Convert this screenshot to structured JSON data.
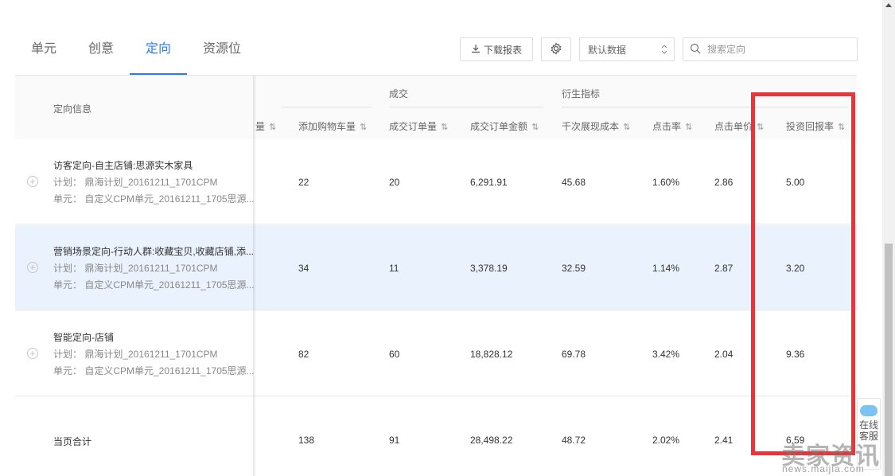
{
  "tabs": [
    {
      "label": "单元"
    },
    {
      "label": "创意"
    },
    {
      "label": "定向"
    },
    {
      "label": "资源位"
    }
  ],
  "active_tab": "定向",
  "toolbar": {
    "download_label": "下载报表",
    "select_value": "默认数据",
    "search_placeholder": "搜索定向"
  },
  "table": {
    "info_header": "定向信息",
    "groups": {
      "deal": "成交",
      "derived": "衍生指标"
    },
    "columns": {
      "partial": "量",
      "add_cart": "添加购物车量",
      "orders": "成交订单量",
      "order_amount": "成交订单金额",
      "cpm": "千次展现成本",
      "ctr": "点击率",
      "cpc": "点击单价",
      "roi": "投资回报率"
    },
    "rows": [
      {
        "title": "访客定向-自主店铺:思源实木家具",
        "plan": "计划： 鼎海计划_20161211_1701CPM",
        "unit": "单元： 自定义CPM单元_20161211_1705思源...",
        "add_cart": "22",
        "orders": "20",
        "order_amount": "6,291.91",
        "cpm": "45.68",
        "ctr": "1.60%",
        "cpc": "2.86",
        "roi": "5.00"
      },
      {
        "title": "营销场景定向-行动人群:收藏宝贝,收藏店铺,添...",
        "plan": "计划： 鼎海计划_20161211_1701CPM",
        "unit": "单元： 自定义CPM单元_20161211_1705思源...",
        "add_cart": "34",
        "orders": "11",
        "order_amount": "3,378.19",
        "cpm": "32.59",
        "ctr": "1.14%",
        "cpc": "2.87",
        "roi": "3.20"
      },
      {
        "title": "智能定向-店铺",
        "plan": "计划： 鼎海计划_20161211_1701CPM",
        "unit": "单元： 自定义CPM单元_20161211_1705思源...",
        "add_cart": "82",
        "orders": "60",
        "order_amount": "18,828.12",
        "cpm": "69.78",
        "ctr": "3.42%",
        "cpc": "2.04",
        "roi": "9.36"
      }
    ],
    "total": {
      "label": "当页合计",
      "add_cart": "138",
      "orders": "91",
      "order_amount": "28,498.22",
      "cpm": "48.72",
      "ctr": "2.02%",
      "cpc": "2.41",
      "roi": "6.59"
    }
  },
  "chat_widget": {
    "line1": "在线",
    "line2": "客服"
  },
  "watermark": {
    "big": "卖家资讯",
    "small": "news.maijia.com"
  },
  "colors": {
    "accent": "#2b7de1",
    "highlight_row": "#eaf2fd",
    "annotation_red": "#e8353a"
  }
}
